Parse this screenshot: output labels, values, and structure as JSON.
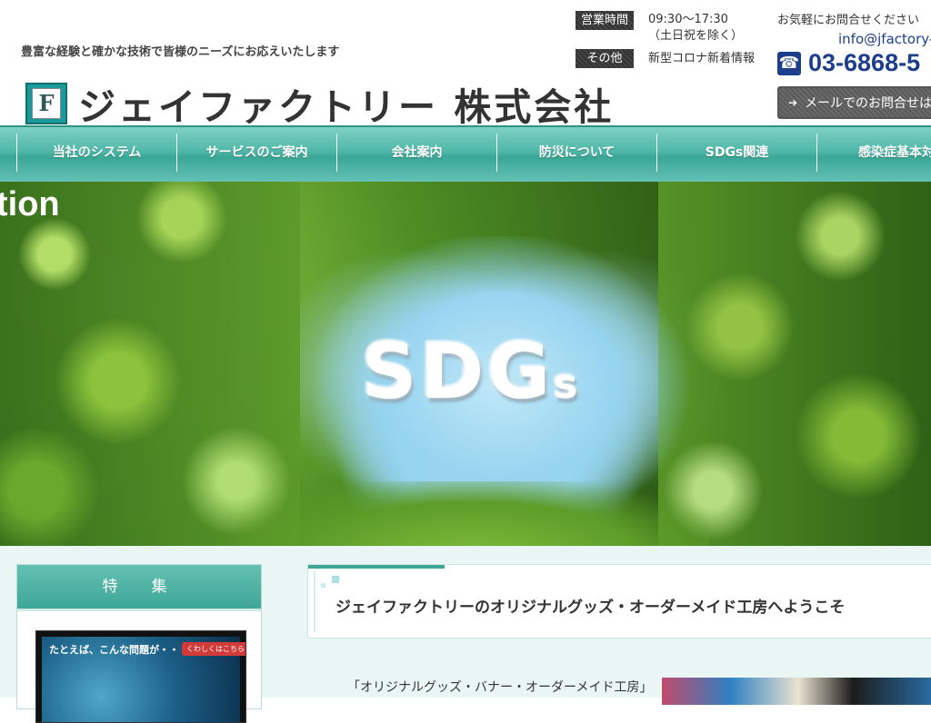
{
  "header": {
    "tagline": "豊富な経験と確かな技術で皆様のニーズにお応えいたします",
    "logo_text": "ジェイファクトリー 株式会社",
    "logo_mark": "F",
    "hours_label": "営業時間",
    "hours_value_1": "09:30〜17:30",
    "hours_value_2": "（土日祝を除く）",
    "other_label": "その他",
    "other_value": "新型コロナ新着情報",
    "contact_lead": "お気軽にお問合せください",
    "email": "info@jfactory-r",
    "phone": "03-6868-5",
    "mail_button": "メールでのお問合せはこ"
  },
  "nav": {
    "items": [
      {
        "label": "当社のシステム"
      },
      {
        "label": "サービスのご案内"
      },
      {
        "label": "会社案内"
      },
      {
        "label": "防災について"
      },
      {
        "label": "SDGs関連"
      },
      {
        "label": "感染症基本対"
      }
    ]
  },
  "hero": {
    "caption": "tion",
    "main_text": "SDG",
    "main_suffix": "s"
  },
  "sidebar": {
    "heading": "特　集",
    "feature_text": "たとえば、こんな問題が・・",
    "feature_button": "くわしくはこちら"
  },
  "main": {
    "welcome_title": "ジェイファクトリーのオリジナルグッズ・オーダーメイド工房へようこそ",
    "intro": "「オリジナルグッズ・バナー・オーダーメイド工房」"
  },
  "colors": {
    "accent": "#3ea697",
    "brand_blue": "#1c3e8c",
    "label_dark": "#3b3b3b"
  }
}
